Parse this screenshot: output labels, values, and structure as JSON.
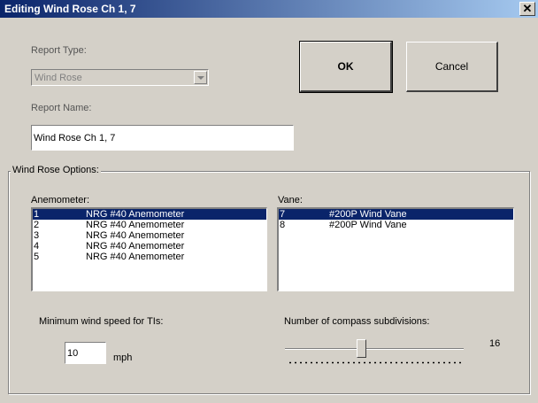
{
  "window": {
    "title": "Editing Wind Rose Ch 1, 7"
  },
  "report_type": {
    "label": "Report Type:",
    "value": "Wind Rose"
  },
  "report_name": {
    "label": "Report Name:",
    "value": "Wind Rose Ch 1, 7"
  },
  "buttons": {
    "ok": "OK",
    "cancel": "Cancel"
  },
  "options": {
    "title": "Wind Rose Options:",
    "anemometer": {
      "label": "Anemometer:",
      "items": [
        {
          "num": "1",
          "name": "NRG #40 Anemometer",
          "selected": true
        },
        {
          "num": "2",
          "name": "NRG #40 Anemometer",
          "selected": false
        },
        {
          "num": "3",
          "name": "NRG #40 Anemometer",
          "selected": false
        },
        {
          "num": "4",
          "name": "NRG #40 Anemometer",
          "selected": false
        },
        {
          "num": "5",
          "name": "NRG #40 Anemometer",
          "selected": false
        }
      ]
    },
    "vane": {
      "label": "Vane:",
      "items": [
        {
          "num": "7",
          "name": "#200P Wind Vane",
          "selected": true
        },
        {
          "num": "8",
          "name": "#200P Wind Vane",
          "selected": false
        }
      ]
    },
    "min_speed": {
      "label": "Minimum wind speed for TIs:",
      "value": "10",
      "unit": "mph"
    },
    "compass": {
      "label": "Number of compass subdivisions:",
      "value": "16",
      "slider_fraction": 0.43
    }
  }
}
